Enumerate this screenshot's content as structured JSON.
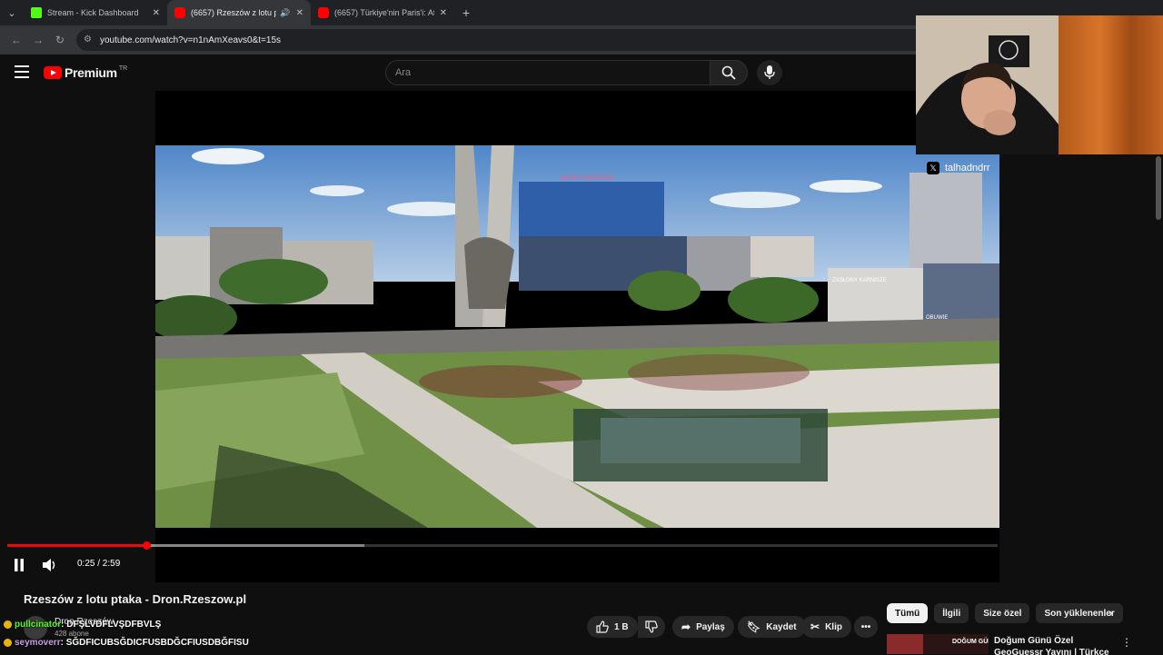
{
  "browser": {
    "tabs": [
      {
        "label": "Stream - Kick Dashboard",
        "favicon": "kick-icon",
        "active": false
      },
      {
        "label": "(6657) Rzeszów z lotu ptaka - Dron.Rzeszow.pl",
        "favicon": "youtube-icon",
        "active": true
      },
      {
        "label": "(6657) Türkiye'nin Paris'i: Atça'ya",
        "favicon": "youtube-icon",
        "active": false
      }
    ],
    "url": "youtube.com/watch?v=n1nAmXeavs0&t=15s"
  },
  "youtube": {
    "brand": "Premium",
    "region": "TR",
    "search_placeholder": "Ara"
  },
  "player": {
    "current_time": "0:25",
    "duration": "2:59",
    "time_display": "0:25 / 2:59",
    "progress_fraction": 0.14,
    "buffered_fraction": 0.36
  },
  "video": {
    "title": "Rzeszów z lotu ptaka - Dron.Rzeszow.pl",
    "channel": "Dron Rzeszów",
    "subscribers": "428 abone",
    "likes": "1 B",
    "share_label": "Paylaş",
    "save_label": "Kaydet",
    "clip_label": "Klip"
  },
  "scene_signs": {
    "hotel": "HOTEL RZESZÓW",
    "store": "ZASŁONY KARNISZE",
    "shop": "OBUWIE"
  },
  "streamer": {
    "handle": "talhadndrr"
  },
  "chips": [
    "Tümü",
    "İlgili",
    "Size özel",
    "Son yüklenenler"
  ],
  "recommendation": {
    "title": "Doğum Günü Özel GeoGuessr Yayını | Türkçe Canlı Yayın",
    "thumb_text": "DOĞUM GÜNÜMÜZ"
  },
  "chat": [
    {
      "user": "pullcinator",
      "message": ": DFŞLVDFLVŞDFBVLŞ"
    },
    {
      "user": "seymoverr",
      "message": ": SĞDFICUBSĞDICFUSBDĞCFIUSDBĞFISU"
    }
  ],
  "colors": {
    "yt_red": "#ff0000",
    "kick_green": "#53fc18",
    "bg": "#0f0f0f"
  }
}
